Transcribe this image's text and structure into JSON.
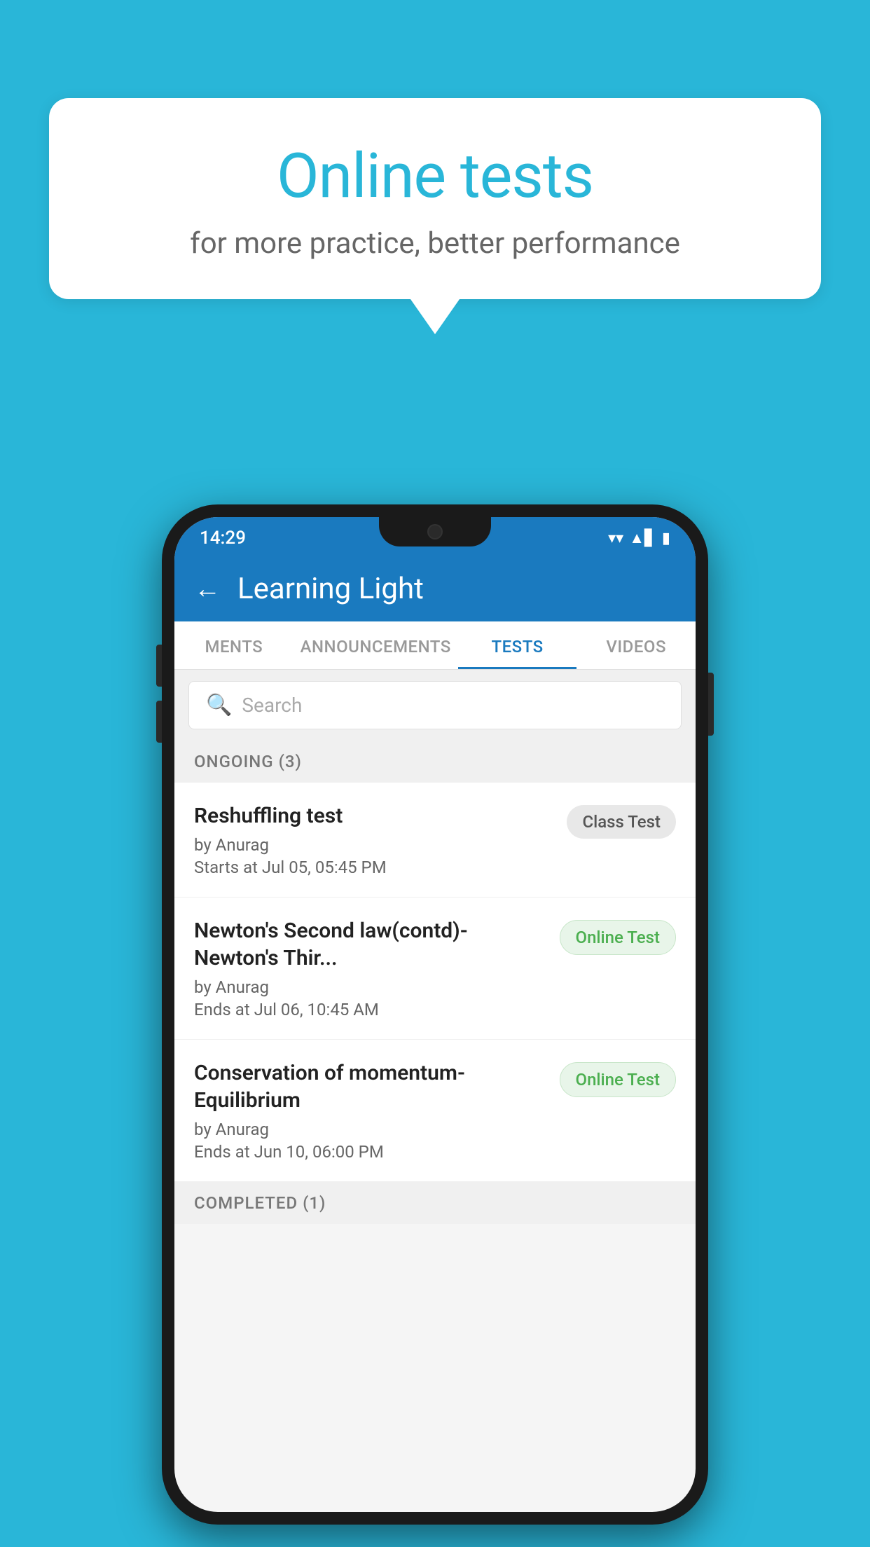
{
  "background_color": "#29b6d8",
  "speech_bubble": {
    "title": "Online tests",
    "subtitle": "for more practice, better performance"
  },
  "phone": {
    "status_bar": {
      "time": "14:29",
      "wifi": "▼",
      "signal": "▲",
      "battery": "▮"
    },
    "header": {
      "back_label": "←",
      "title": "Learning Light"
    },
    "tabs": [
      {
        "label": "MENTS",
        "active": false
      },
      {
        "label": "ANNOUNCEMENTS",
        "active": false
      },
      {
        "label": "TESTS",
        "active": true
      },
      {
        "label": "VIDEOS",
        "active": false
      }
    ],
    "search": {
      "placeholder": "Search"
    },
    "sections": [
      {
        "label": "ONGOING (3)",
        "items": [
          {
            "name": "Reshuffling test",
            "by": "by Anurag",
            "date": "Starts at  Jul 05, 05:45 PM",
            "badge": "Class Test",
            "badge_type": "class"
          },
          {
            "name": "Newton's Second law(contd)-Newton's Thir...",
            "by": "by Anurag",
            "date": "Ends at  Jul 06, 10:45 AM",
            "badge": "Online Test",
            "badge_type": "online"
          },
          {
            "name": "Conservation of momentum-Equilibrium",
            "by": "by Anurag",
            "date": "Ends at  Jun 10, 06:00 PM",
            "badge": "Online Test",
            "badge_type": "online"
          }
        ]
      }
    ],
    "completed_section_label": "COMPLETED (1)"
  }
}
